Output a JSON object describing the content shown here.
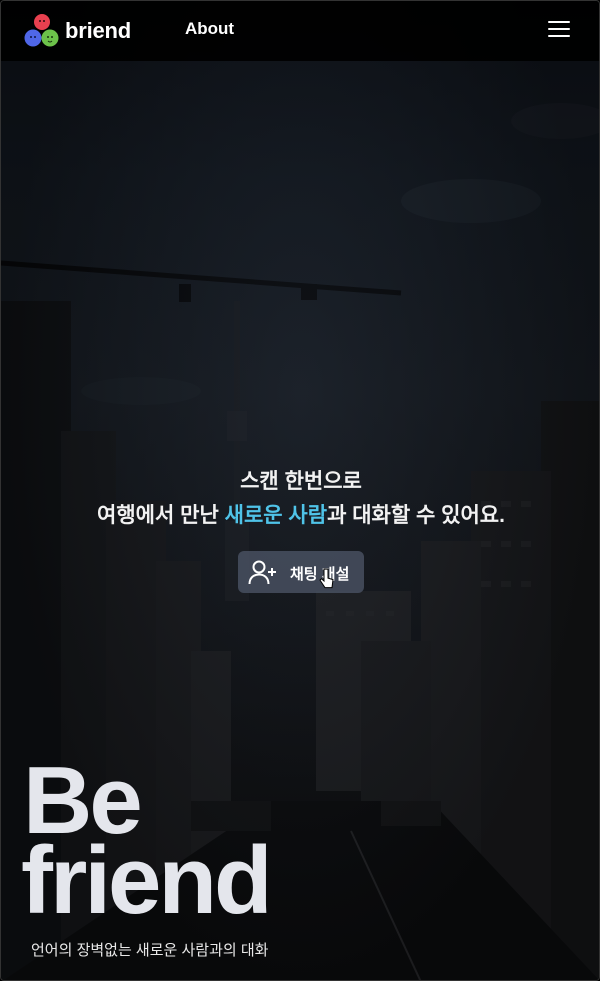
{
  "header": {
    "logo_text": "briend",
    "nav_about": "About"
  },
  "hero": {
    "line1": "스캔 한번으로",
    "line2_prefix": "여행에서 만난 ",
    "line2_accent": "새로운 사람",
    "line2_suffix": "과 대화할 수 있어요.",
    "cta_label": "채팅 개설"
  },
  "brand": {
    "big_line1": "Be",
    "big_line2": "friend",
    "tagline": "언어의 장벽없는 새로운 사람과의 대화"
  },
  "colors": {
    "accent": "#4fc3e8",
    "logo_red": "#e8404f",
    "logo_blue": "#4f67e8",
    "logo_green": "#6cc24a"
  },
  "icons": {
    "logo": "briend-logo-icon",
    "menu": "hamburger-menu-icon",
    "cta": "add-user-icon",
    "cursor": "pointer-cursor-icon"
  }
}
